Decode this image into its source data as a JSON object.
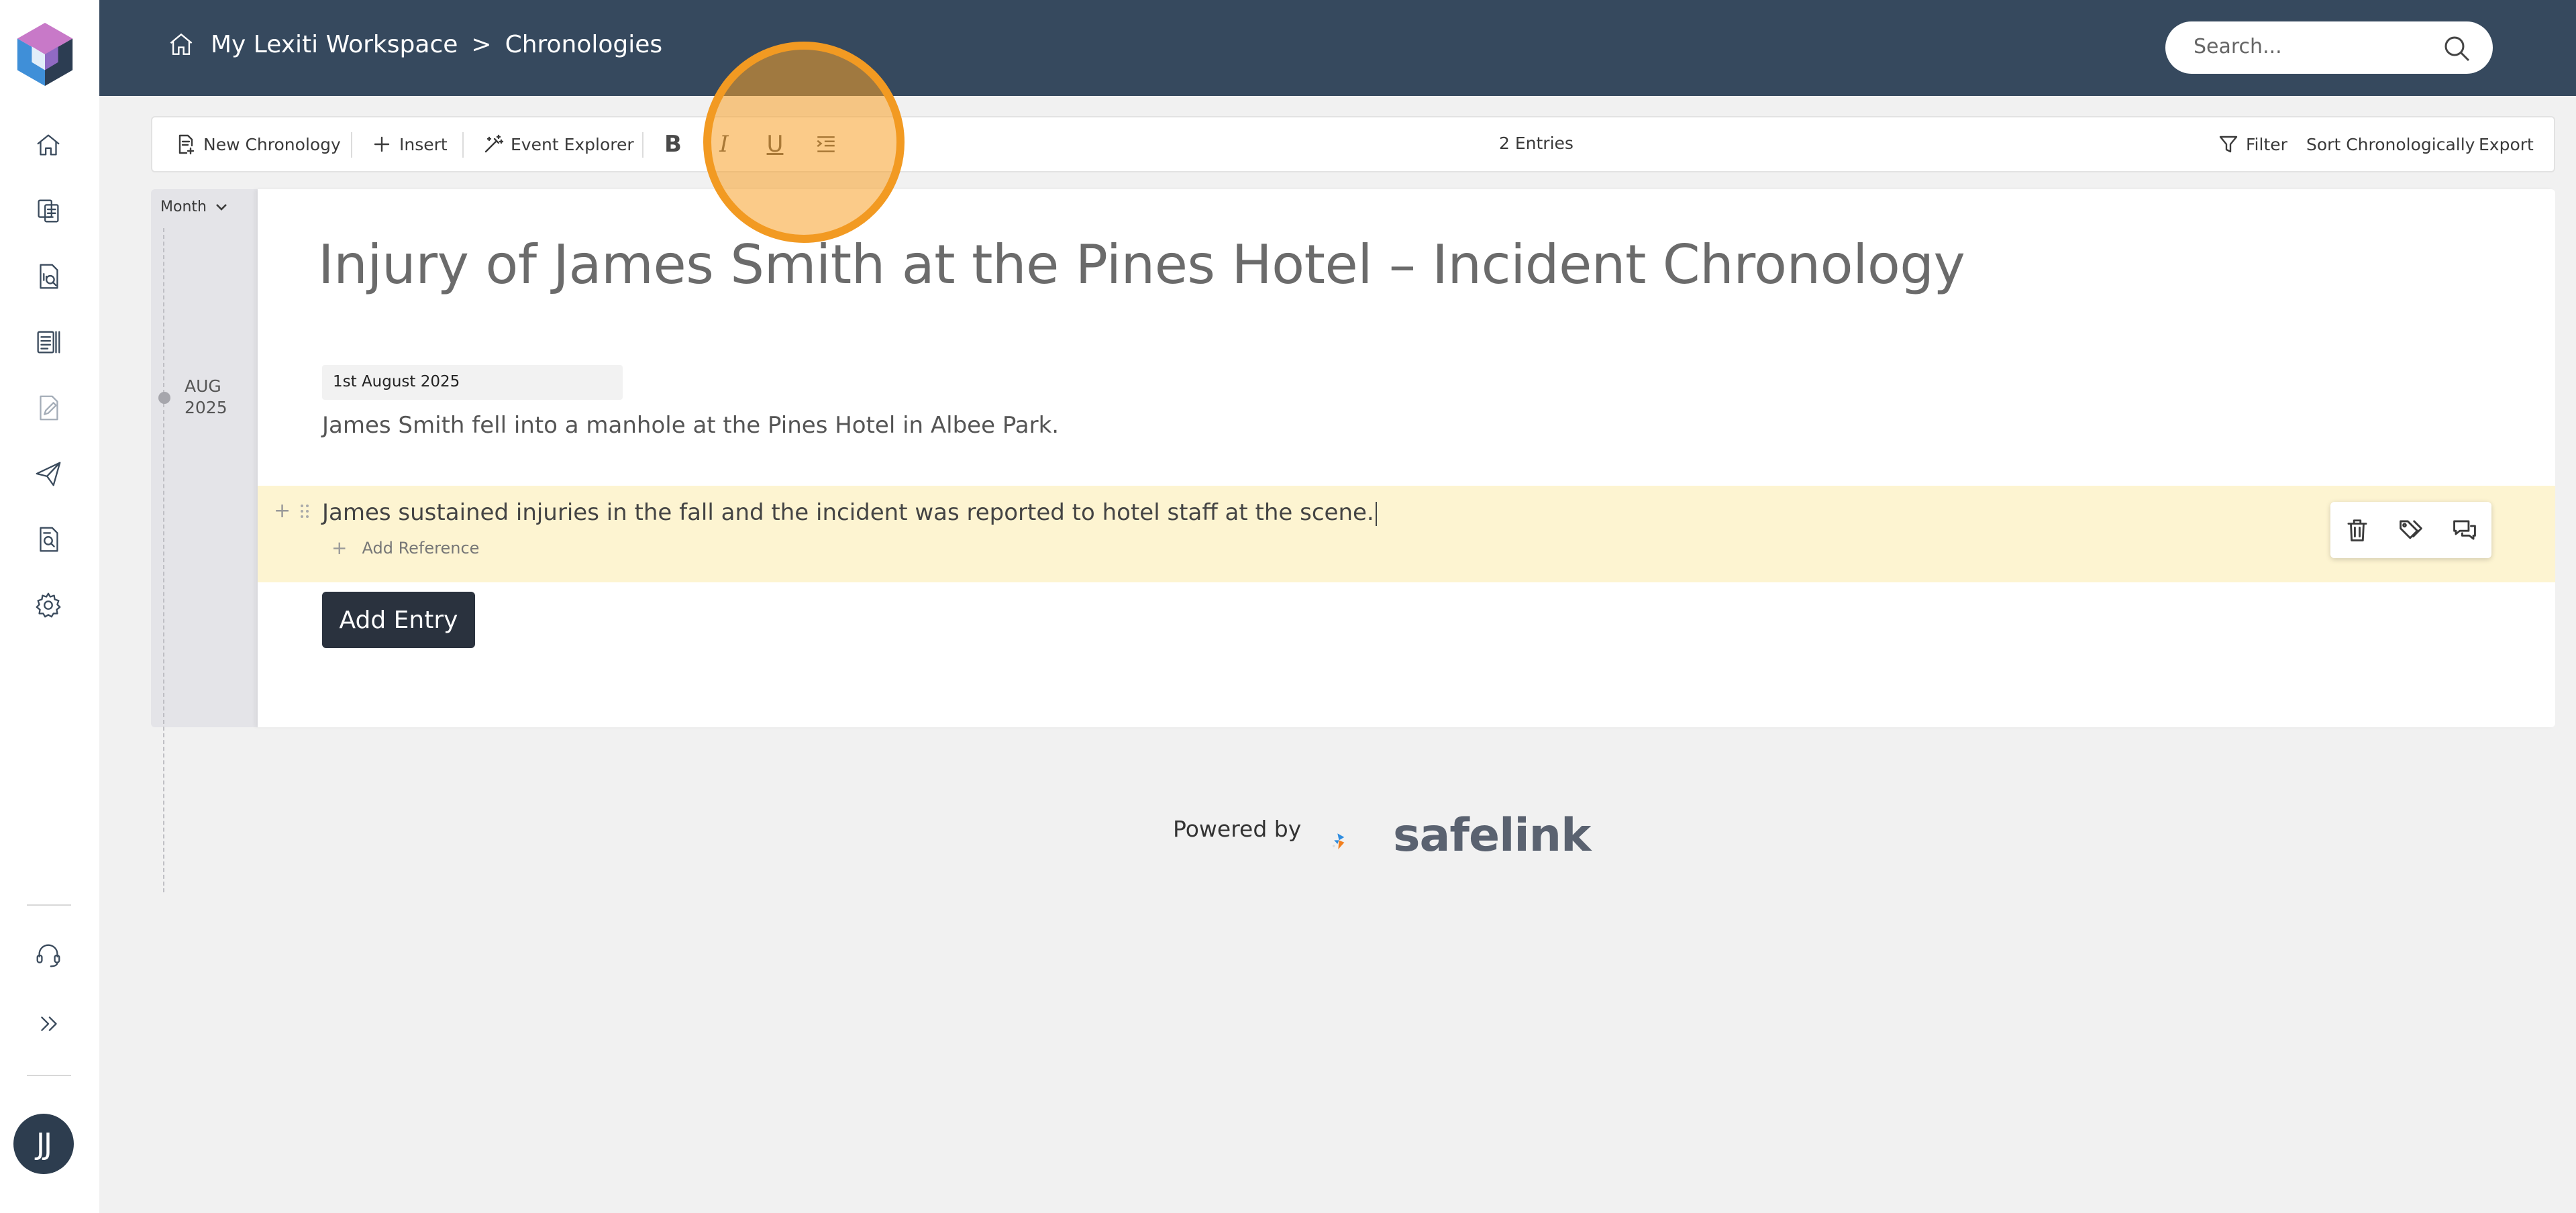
{
  "breadcrumb": {
    "workspace": "My Lexiti Workspace",
    "separator": ">",
    "current": "Chronologies"
  },
  "search": {
    "placeholder": "Search..."
  },
  "toolbar": {
    "new_chronology": "New Chronology",
    "insert": "Insert",
    "event_explorer": "Event Explorer",
    "bold": "B",
    "italic": "I",
    "underline": "U",
    "entries_count": "2 Entries",
    "filter": "Filter",
    "sort": "Sort Chronologically",
    "export": "Export"
  },
  "timeline": {
    "grouping": "Month",
    "month": "AUG",
    "year": "2025"
  },
  "document": {
    "title": "Injury of James Smith at the Pines Hotel – Incident Chronology",
    "entry_date": "1st August 2025",
    "entry1_text": "James Smith fell into a manhole at the Pines Hotel in Albee Park.",
    "entry2_text": "James sustained injuries in the fall and the incident was reported to hotel staff at the scene.",
    "add_reference": "Add Reference",
    "add_entry": "Add Entry"
  },
  "user": {
    "initials": "JJ"
  },
  "footer": {
    "powered_by": "Powered by",
    "brand": "safelink"
  },
  "colors": {
    "header_bg": "#36495e",
    "highlight_row": "#fdf4d1",
    "cursor_ring": "#f29a22",
    "primary_button": "#2a323e"
  }
}
